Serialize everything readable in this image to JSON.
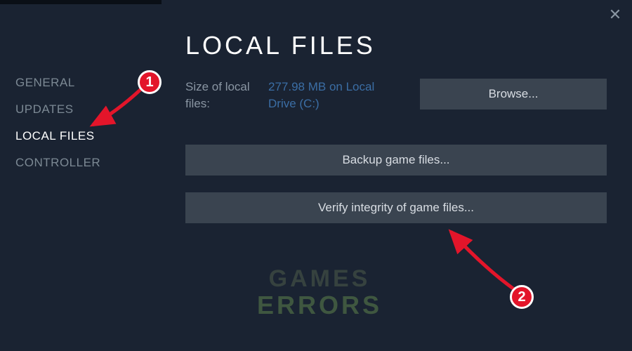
{
  "sidebar": {
    "items": [
      {
        "label": "GENERAL"
      },
      {
        "label": "UPDATES"
      },
      {
        "label": "LOCAL FILES"
      },
      {
        "label": "CONTROLLER"
      }
    ]
  },
  "main": {
    "title": "LOCAL FILES",
    "size_label": "Size of local files:",
    "size_value": "277.98 MB on Local Drive (C:)",
    "browse_label": "Browse...",
    "backup_label": "Backup game files...",
    "verify_label": "Verify integrity of game files..."
  },
  "watermark": {
    "line1": "GAMES",
    "line2": "ERRORS"
  },
  "annotations": {
    "marker1": "1",
    "marker2": "2"
  }
}
